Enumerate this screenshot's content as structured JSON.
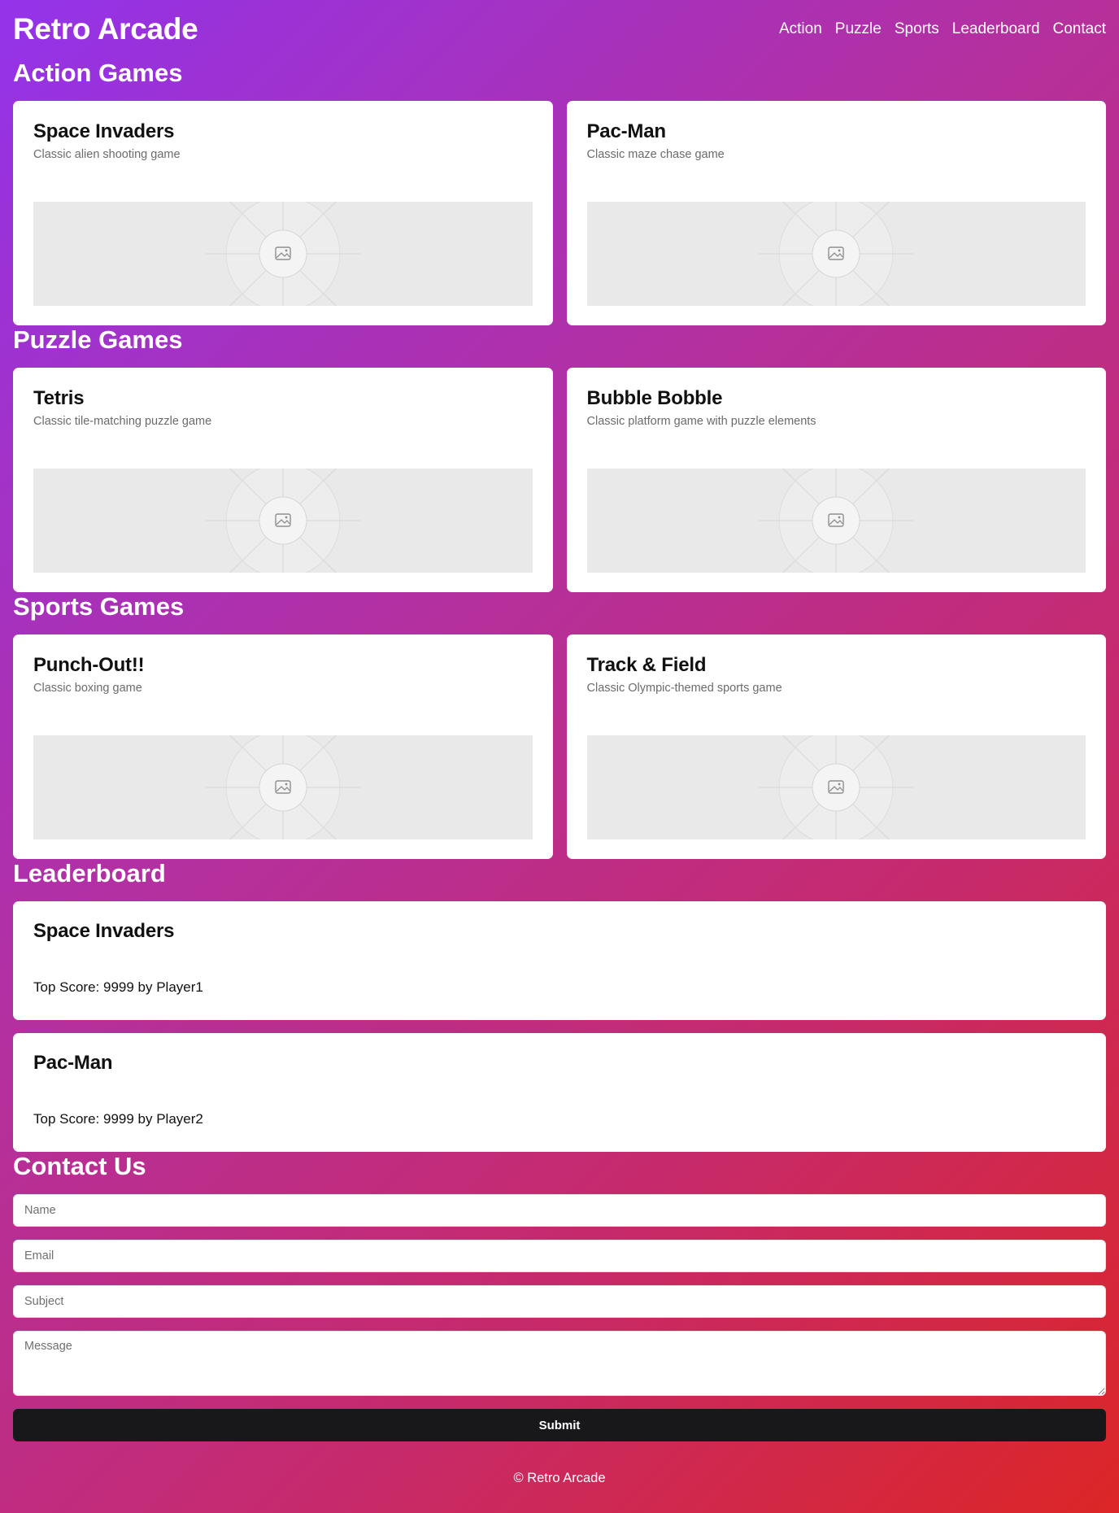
{
  "header": {
    "title": "Retro Arcade",
    "nav": [
      "Action",
      "Puzzle",
      "Sports",
      "Leaderboard",
      "Contact"
    ]
  },
  "sections": {
    "action": {
      "title": "Action Games",
      "games": [
        {
          "title": "Space Invaders",
          "desc": "Classic alien shooting game"
        },
        {
          "title": "Pac-Man",
          "desc": "Classic maze chase game"
        }
      ]
    },
    "puzzle": {
      "title": "Puzzle Games",
      "games": [
        {
          "title": "Tetris",
          "desc": "Classic tile-matching puzzle game"
        },
        {
          "title": "Bubble Bobble",
          "desc": "Classic platform game with puzzle elements"
        }
      ]
    },
    "sports": {
      "title": "Sports Games",
      "games": [
        {
          "title": "Punch-Out!!",
          "desc": "Classic boxing game"
        },
        {
          "title": "Track & Field",
          "desc": "Classic Olympic-themed sports game"
        }
      ]
    }
  },
  "leaderboard": {
    "title": "Leaderboard",
    "entries": [
      {
        "game": "Space Invaders",
        "score": "Top Score: 9999 by Player1"
      },
      {
        "game": "Pac-Man",
        "score": "Top Score: 9999 by Player2"
      }
    ]
  },
  "contact": {
    "title": "Contact Us",
    "name_placeholder": "Name",
    "email_placeholder": "Email",
    "subject_placeholder": "Subject",
    "message_placeholder": "Message",
    "submit_label": "Submit"
  },
  "footer": {
    "text": "© Retro Arcade"
  },
  "icons": {
    "placeholder": "image-placeholder-icon"
  },
  "colors": {
    "gradient_start": "#9333ea",
    "gradient_end": "#dc2626",
    "button": "#18181b",
    "thumb_bg": "#e9e9e9"
  }
}
